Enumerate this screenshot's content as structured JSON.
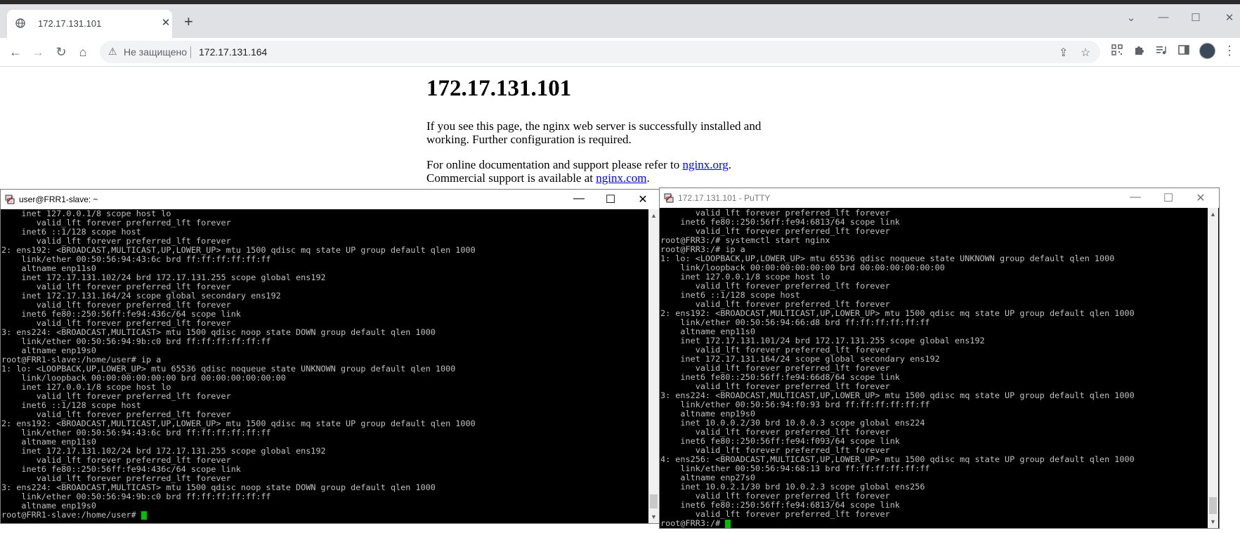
{
  "browser": {
    "tab_title": "172.17.131.101",
    "new_tab": "+",
    "tab_close": "✕",
    "not_secure": "Не защищено",
    "url": "172.17.131.164",
    "window_controls": {
      "dropdown": "⌄",
      "minimize": "—",
      "maximize": "☐",
      "close": "✕"
    },
    "nav": {
      "back": "←",
      "forward": "→",
      "reload": "↻",
      "home": "⌂"
    },
    "omnibox_icons": {
      "share": "⇪",
      "bookmark": "☆",
      "warning": "⚠"
    },
    "extension_icons": [
      "qr-icon",
      "puzzle-icon",
      "media-icon",
      "sidepanel-icon"
    ],
    "menu": "⋮"
  },
  "page": {
    "heading": "172.17.131.101",
    "para1": "If you see this page, the nginx web server is successfully installed and working. Further configuration is required.",
    "para2_prefix": "For online documentation and support please refer to ",
    "link1": "nginx.org",
    "para2_mid": ".",
    "para3_prefix": "Commercial support is available at ",
    "link2": "nginx.com",
    "para3_suffix": "."
  },
  "left_terminal": {
    "title": "user@FRR1-slave: ~",
    "controls": {
      "minimize": "—",
      "maximize": "☐",
      "close": "✕"
    },
    "lines": [
      "    inet 127.0.0.1/8 scope host lo",
      "       valid_lft forever preferred_lft forever",
      "    inet6 ::1/128 scope host",
      "       valid_lft forever preferred_lft forever",
      "2: ens192: <BROADCAST,MULTICAST,UP,LOWER_UP> mtu 1500 qdisc mq state UP group default qlen 1000",
      "    link/ether 00:50:56:94:43:6c brd ff:ff:ff:ff:ff:ff",
      "    altname enp11s0",
      "    inet 172.17.131.102/24 brd 172.17.131.255 scope global ens192",
      "       valid_lft forever preferred_lft forever",
      "    inet 172.17.131.164/24 scope global secondary ens192",
      "       valid_lft forever preferred_lft forever",
      "    inet6 fe80::250:56ff:fe94:436c/64 scope link",
      "       valid_lft forever preferred_lft forever",
      "3: ens224: <BROADCAST,MULTICAST> mtu 1500 qdisc noop state DOWN group default qlen 1000",
      "    link/ether 00:50:56:94:9b:c0 brd ff:ff:ff:ff:ff:ff",
      "    altname enp19s0",
      "root@FRR1-slave:/home/user# ip a",
      "1: lo: <LOOPBACK,UP,LOWER_UP> mtu 65536 qdisc noqueue state UNKNOWN group default qlen 1000",
      "    link/loopback 00:00:00:00:00:00 brd 00:00:00:00:00:00",
      "    inet 127.0.0.1/8 scope host lo",
      "       valid_lft forever preferred_lft forever",
      "    inet6 ::1/128 scope host",
      "       valid_lft forever preferred_lft forever",
      "2: ens192: <BROADCAST,MULTICAST,UP,LOWER_UP> mtu 1500 qdisc mq state UP group default qlen 1000",
      "    link/ether 00:50:56:94:43:6c brd ff:ff:ff:ff:ff:ff",
      "    altname enp11s0",
      "    inet 172.17.131.102/24 brd 172.17.131.255 scope global ens192",
      "       valid_lft forever preferred_lft forever",
      "    inet6 fe80::250:56ff:fe94:436c/64 scope link",
      "       valid_lft forever preferred_lft forever",
      "3: ens224: <BROADCAST,MULTICAST> mtu 1500 qdisc noop state DOWN group default qlen 1000",
      "    link/ether 00:50:56:94:9b:c0 brd ff:ff:ff:ff:ff:ff",
      "    altname enp19s0"
    ],
    "prompt": "root@FRR1-slave:/home/user# "
  },
  "right_terminal": {
    "title": "172.17.131.101 - PuTTY",
    "controls": {
      "minimize": "—",
      "maximize": "☐",
      "close": "✕"
    },
    "lines": [
      "       valid_lft forever preferred_lft forever",
      "    inet6 fe80::250:56ff:fe94:6813/64 scope link",
      "       valid_lft forever preferred_lft forever",
      "root@FRR3:/# systemctl start nginx",
      "root@FRR3:/# ip a",
      "1: lo: <LOOPBACK,UP,LOWER_UP> mtu 65536 qdisc noqueue state UNKNOWN group default qlen 1000",
      "    link/loopback 00:00:00:00:00:00 brd 00:00:00:00:00:00",
      "    inet 127.0.0.1/8 scope host lo",
      "       valid_lft forever preferred_lft forever",
      "    inet6 ::1/128 scope host",
      "       valid_lft forever preferred_lft forever",
      "2: ens192: <BROADCAST,MULTICAST,UP,LOWER_UP> mtu 1500 qdisc mq state UP group default qlen 1000",
      "    link/ether 00:50:56:94:66:d8 brd ff:ff:ff:ff:ff:ff",
      "    altname enp11s0",
      "    inet 172.17.131.101/24 brd 172.17.131.255 scope global ens192",
      "       valid_lft forever preferred_lft forever",
      "    inet 172.17.131.164/24 scope global secondary ens192",
      "       valid_lft forever preferred_lft forever",
      "    inet6 fe80::250:56ff:fe94:66d8/64 scope link",
      "       valid_lft forever preferred_lft forever",
      "3: ens224: <BROADCAST,MULTICAST,UP,LOWER_UP> mtu 1500 qdisc mq state UP group default qlen 1000",
      "    link/ether 00:50:56:94:f0:93 brd ff:ff:ff:ff:ff:ff",
      "    altname enp19s0",
      "    inet 10.0.0.2/30 brd 10.0.0.3 scope global ens224",
      "       valid_lft forever preferred_lft forever",
      "    inet6 fe80::250:56ff:fe94:f093/64 scope link",
      "       valid_lft forever preferred_lft forever",
      "4: ens256: <BROADCAST,MULTICAST,UP,LOWER_UP> mtu 1500 qdisc mq state UP group default qlen 1000",
      "    link/ether 00:50:56:94:68:13 brd ff:ff:ff:ff:ff:ff",
      "    altname enp27s0",
      "    inet 10.0.2.1/30 brd 10.0.2.3 scope global ens256",
      "       valid_lft forever preferred_lft forever",
      "    inet6 fe80::250:56ff:fe94:6813/64 scope link",
      "       valid_lft forever preferred_lft forever"
    ],
    "prompt": "root@FRR3:/# "
  },
  "colors": {
    "terminal_bg": "#000000",
    "terminal_fg": "#c0c0c0",
    "cursor": "#00c000",
    "link": "#0000ee"
  },
  "scrollbar_arrows": {
    "up": "▲",
    "down": "▼"
  }
}
